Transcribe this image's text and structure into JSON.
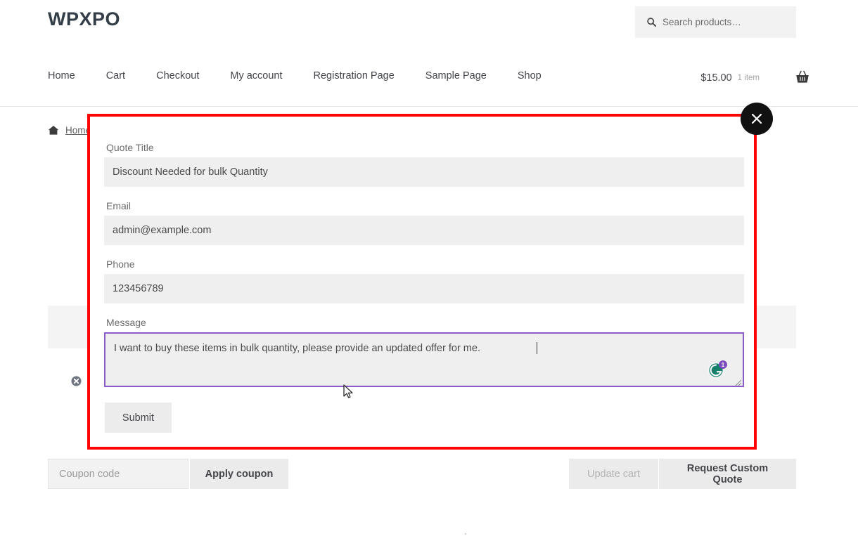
{
  "header": {
    "logo": "WPXPO",
    "search": {
      "placeholder": "Search products…",
      "value": "",
      "icon": "search-icon"
    },
    "nav": [
      {
        "label": "Home"
      },
      {
        "label": "Cart"
      },
      {
        "label": "Checkout"
      },
      {
        "label": "My account"
      },
      {
        "label": "Registration Page"
      },
      {
        "label": "Sample Page"
      },
      {
        "label": "Shop"
      }
    ],
    "cart": {
      "amount": "$15.00",
      "count": "1 item",
      "icon": "shopping-basket-icon"
    }
  },
  "breadcrumb": {
    "home_icon": "home-icon",
    "home_label": "Home"
  },
  "cart_actions": {
    "coupon_placeholder": "Coupon code",
    "coupon_value": "",
    "apply_coupon_label": "Apply coupon",
    "update_cart_label": "Update cart",
    "request_quote_label": "Request Custom Quote"
  },
  "modal": {
    "highlight_color": "#fc0505",
    "focus_color": "#8b5cc7",
    "close_icon": "close-icon",
    "fields": [
      {
        "label": "Quote Title",
        "value": "Discount Needed for bulk Quantity",
        "name": "quote-title"
      },
      {
        "label": "Email",
        "value": "admin@example.com",
        "name": "email"
      },
      {
        "label": "Phone",
        "value": "123456789",
        "name": "phone"
      }
    ],
    "message": {
      "label": "Message",
      "value": "I want to buy these items in bulk quantity, please provide an updated offer for me."
    },
    "grammar_badge": {
      "icon": "grammarly-icon",
      "count": "1"
    },
    "submit_label": "Submit"
  }
}
